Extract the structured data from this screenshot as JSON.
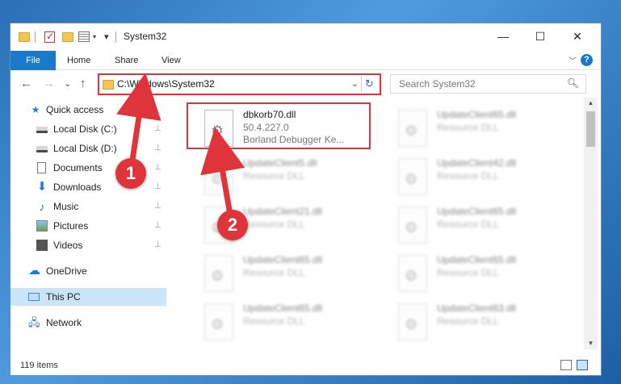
{
  "window": {
    "title": "System32",
    "controls": {
      "minimize": "—",
      "maximize": "☐",
      "close": "✕"
    }
  },
  "ribbon": {
    "tabs": [
      {
        "label": "File",
        "active": true
      },
      {
        "label": "Home"
      },
      {
        "label": "Share"
      },
      {
        "label": "View"
      }
    ],
    "help": "?"
  },
  "navigation": {
    "back": "←",
    "forward": "→",
    "recent": "⌄",
    "up": "↑",
    "address": "C:\\Windows\\System32",
    "refresh": "↻",
    "search_placeholder": "Search System32"
  },
  "sidebar": {
    "items": [
      {
        "label": "Quick access",
        "icon": "star-icon",
        "pinned": false
      },
      {
        "label": "Local Disk (C:)",
        "icon": "drive-icon",
        "pinned": true
      },
      {
        "label": "Local Disk (D:)",
        "icon": "drive-icon",
        "pinned": true
      },
      {
        "label": "Documents",
        "icon": "document-icon",
        "pinned": true
      },
      {
        "label": "Downloads",
        "icon": "download-icon",
        "pinned": true
      },
      {
        "label": "Music",
        "icon": "music-icon",
        "pinned": true
      },
      {
        "label": "Pictures",
        "icon": "pictures-icon",
        "pinned": true
      },
      {
        "label": "Videos",
        "icon": "videos-icon",
        "pinned": true
      },
      {
        "label": "OneDrive",
        "icon": "cloud-icon",
        "pinned": false
      },
      {
        "label": "This PC",
        "icon": "computer-icon",
        "pinned": false,
        "selected": true
      },
      {
        "label": "Network",
        "icon": "network-icon",
        "pinned": false
      }
    ],
    "pin_glyph": "📌"
  },
  "files": [
    {
      "name": "dbkorb70.dll",
      "line2": "50.4.227.0",
      "line3": "Borland Debugger Ke...",
      "highlighted": true
    },
    {
      "name": "UpdateClient65.dll",
      "line2": "Resource DLL"
    },
    {
      "name": "UpdateClient5.dll",
      "line2": "Resource DLL"
    },
    {
      "name": "UpdateClient42.dll",
      "line2": "Resource DLL"
    },
    {
      "name": "UpdateClient21.dll",
      "line2": "Resource DLL"
    },
    {
      "name": "UpdateClient65.dll",
      "line2": "Resource DLL"
    },
    {
      "name": "UpdateClient65.dll",
      "line2": "Resource DLL"
    },
    {
      "name": "UpdateClient65.dll",
      "line2": "Resource DLL"
    },
    {
      "name": "UpdateClient65.dll",
      "line2": "Resource DLL"
    },
    {
      "name": "UpdateClient63.dll",
      "line2": "Resource DLL"
    }
  ],
  "status": {
    "count": "119 items"
  },
  "annotations": {
    "marker1": "1",
    "marker2": "2"
  },
  "colors": {
    "accent": "#1979ca",
    "highlight": "#e0343b",
    "selected": "#cce4f7"
  }
}
